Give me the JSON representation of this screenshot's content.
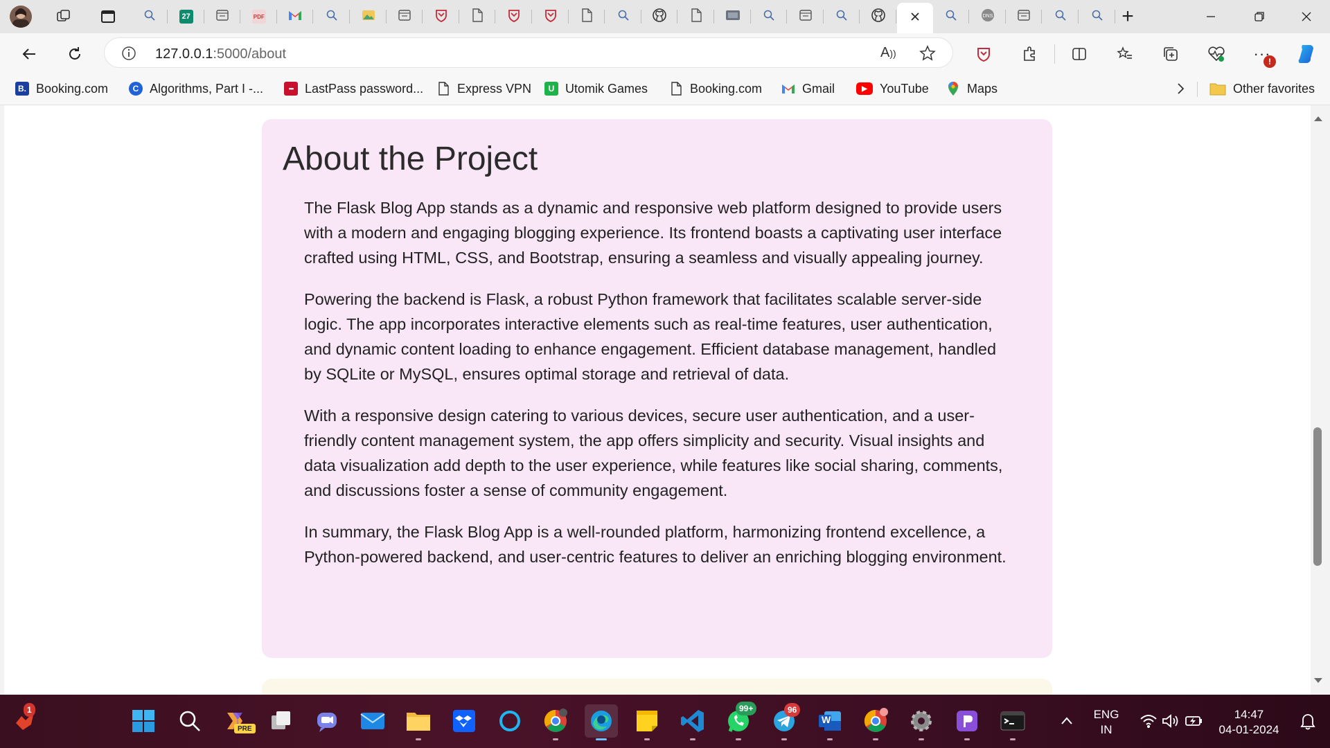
{
  "browser": {
    "tabs": [
      {
        "icon": "search-icon"
      },
      {
        "icon": "calendar-27-icon",
        "text": "27"
      },
      {
        "icon": "tab-page-icon"
      },
      {
        "icon": "pdf-icon",
        "text": "PDF"
      },
      {
        "icon": "gmail-icon"
      },
      {
        "icon": "search-icon"
      },
      {
        "icon": "image-icon"
      },
      {
        "icon": "tab-page-icon"
      },
      {
        "icon": "shield-icon"
      },
      {
        "icon": "document-icon"
      },
      {
        "icon": "shield-icon"
      },
      {
        "icon": "shield-icon"
      },
      {
        "icon": "document-icon"
      },
      {
        "icon": "search-icon"
      },
      {
        "icon": "github-icon"
      },
      {
        "icon": "document-icon"
      },
      {
        "icon": "video-icon"
      },
      {
        "icon": "search-icon"
      },
      {
        "icon": "tab-page-icon"
      },
      {
        "icon": "search-icon"
      },
      {
        "icon": "github-icon"
      },
      {
        "icon": "close-icon",
        "active": true
      },
      {
        "icon": "search-icon"
      },
      {
        "icon": "globe-icon"
      },
      {
        "icon": "tab-page-icon"
      },
      {
        "icon": "search-icon"
      },
      {
        "icon": "search-icon"
      }
    ],
    "new_tab_label": "+",
    "address": {
      "host": "127.0.0.1",
      "path": ":5000/about"
    },
    "read_aloud_label": "A",
    "notification_badge": "!"
  },
  "favorites": {
    "items": [
      {
        "label": "Booking.com",
        "icon": "booking-icon",
        "glyph": "B."
      },
      {
        "label": "Algorithms, Part I -...",
        "icon": "coursera-icon",
        "glyph": "C"
      },
      {
        "label": "LastPass password...",
        "icon": "lastpass-icon",
        "glyph": "•••"
      },
      {
        "label": "Express VPN",
        "icon": "document-icon",
        "glyph": ""
      },
      {
        "label": "Utomik Games",
        "icon": "utomik-icon",
        "glyph": "U"
      },
      {
        "label": "Booking.com",
        "icon": "document-icon",
        "glyph": ""
      },
      {
        "label": "Gmail",
        "icon": "gmail-icon",
        "glyph": "M"
      },
      {
        "label": "YouTube",
        "icon": "youtube-icon",
        "glyph": "▶"
      },
      {
        "label": "Maps",
        "icon": "maps-icon",
        "glyph": ""
      }
    ],
    "other_favorites": "Other favorites"
  },
  "page": {
    "title": "About the Project",
    "paragraphs": [
      "The Flask Blog App stands as a dynamic and responsive web platform designed to provide users with a modern and engaging blogging experience. Its frontend boasts a captivating user interface crafted using HTML, CSS, and Bootstrap, ensuring a seamless and visually appealing journey.",
      "Powering the backend is Flask, a robust Python framework that facilitates scalable server-side logic. The app incorporates interactive elements such as real-time features, user authentication, and dynamic content loading to enhance engagement. Efficient database management, handled by SQLite or MySQL, ensures optimal storage and retrieval of data.",
      "With a responsive design catering to various devices, secure user authentication, and a user-friendly content management system, the app offers simplicity and security. Visual insights and data visualization add depth to the user experience, while features like social sharing, comments, and discussions foster a sense of community engagement.",
      "In summary, the Flask Blog App is a well-rounded platform, harmonizing frontend excellence, a Python-powered backend, and user-centric features to deliver an enriching blogging environment."
    ],
    "card_color": "#f9e6f7"
  },
  "taskbar": {
    "antivirus_badge": "1",
    "copilot_label": "PRE",
    "whatsapp_badge": "99+",
    "telegram_badge": "96",
    "word_label": "W",
    "language": "ENG",
    "region": "IN",
    "time": "14:47",
    "date": "04-01-2024"
  }
}
